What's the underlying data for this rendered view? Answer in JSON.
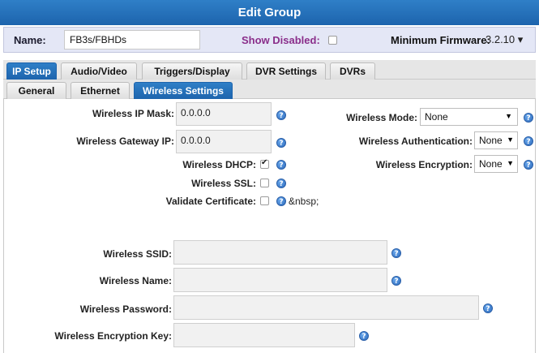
{
  "title": "Edit Group",
  "header": {
    "name_label": "Name:",
    "name_value": "FB3s/FBHDs",
    "show_disabled_label": "Show Disabled:",
    "show_disabled_checked": false,
    "min_firmware_label": "Minimum Firmware:",
    "min_firmware_value": "3.2.10 ▾"
  },
  "tabs": [
    {
      "label": "IP Setup",
      "active": true
    },
    {
      "label": "Audio/Video",
      "active": false
    },
    {
      "label": "Triggers/Display",
      "active": false
    },
    {
      "label": "DVR Settings",
      "active": false
    },
    {
      "label": "DVRs",
      "active": false
    }
  ],
  "subtabs": [
    {
      "label": "General",
      "active": false
    },
    {
      "label": "Ethernet",
      "active": false
    },
    {
      "label": "Wireless Settings",
      "active": true
    }
  ],
  "form": {
    "ip_mask_label": "Wireless IP Mask:",
    "ip_mask_value": "0.0.0.0",
    "gateway_label": "Wireless Gateway IP:",
    "gateway_value": "0.0.0.0",
    "dhcp_label": "Wireless DHCP:",
    "dhcp_checked": true,
    "ssl_label": "Wireless SSL:",
    "ssl_checked": false,
    "validate_label": "Validate Certificate:",
    "validate_checked": false,
    "validate_suffix": "&nbsp;",
    "mode_label": "Wireless Mode:",
    "mode_value": "None",
    "auth_label": "Wireless Authentication:",
    "auth_value": "None",
    "encryption_label": "Wireless Encryption:",
    "encryption_value": "None",
    "ssid_label": "Wireless SSID:",
    "ssid_value": "",
    "name_label": "Wireless Name:",
    "name_value": "",
    "password_label": "Wireless Password:",
    "password_value": "",
    "key_label": "Wireless Encryption Key:",
    "key_value": ""
  },
  "help_glyph": "?",
  "dropdown_arrow": "▼",
  "colors": {
    "title_bar": "#1d64ad",
    "header_bg": "#e4e7f6",
    "show_disabled_text": "#8a2e8a",
    "help_icon": "#2d6bbd"
  }
}
